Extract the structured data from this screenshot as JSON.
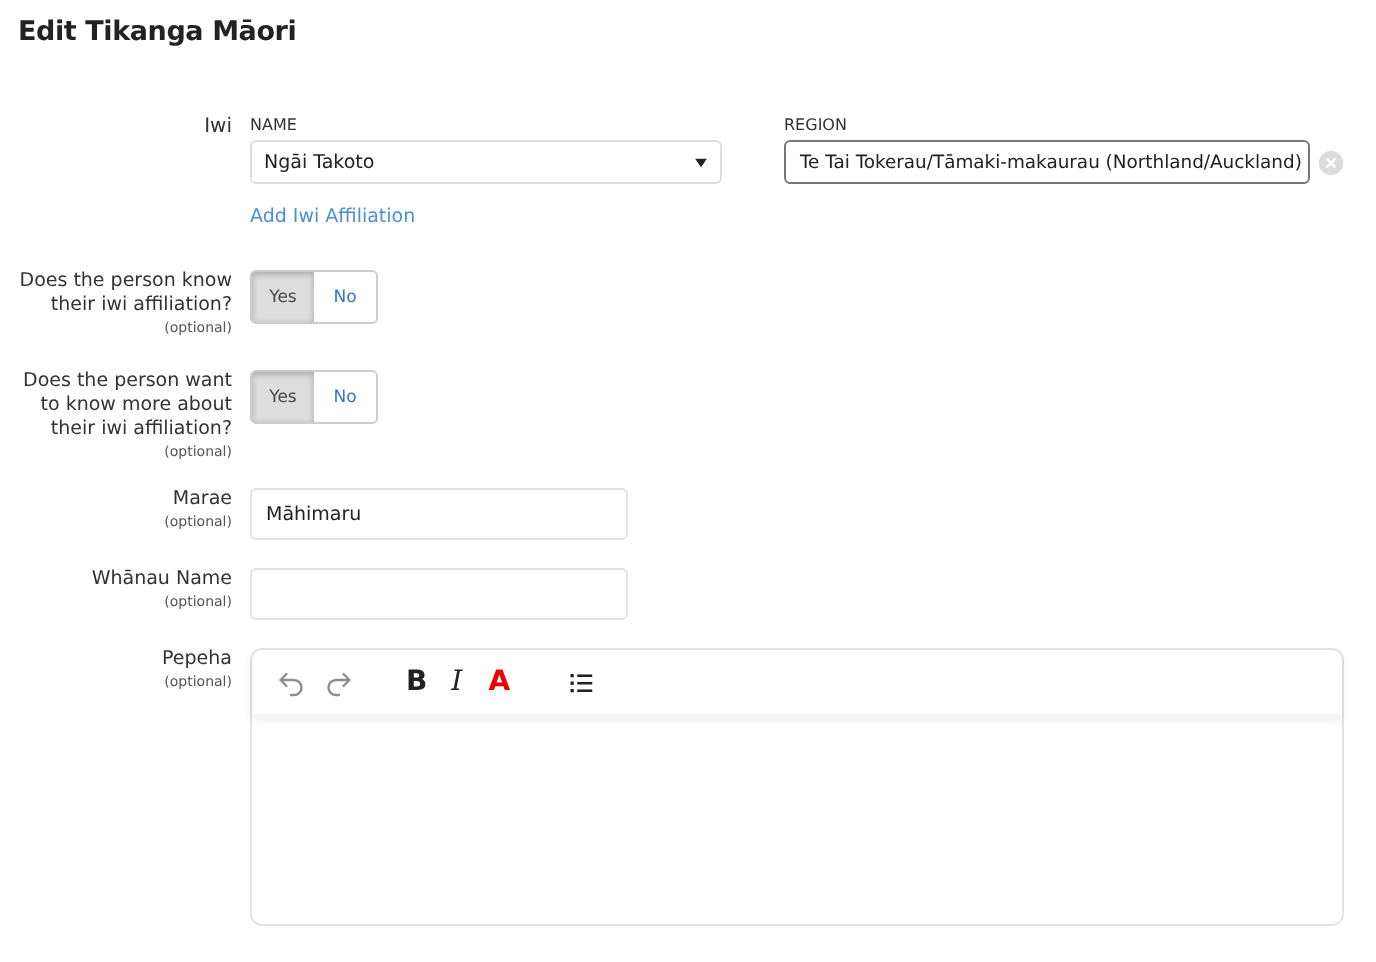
{
  "title": "Edit Tikanga Māori",
  "rows": [
    {
      "kind": "iwi",
      "label": "Iwi",
      "name_label": "NAME",
      "name_value": "Ngāi Takoto",
      "region_label": "REGION",
      "region_value": "Te Tai Tokerau/Tāmaki-makaurau (Northland/Auckland)",
      "add_link": "Add Iwi Affiliation"
    },
    {
      "kind": "toggle",
      "label": "Does the person know their iwi affiliation?",
      "optional": "(optional)",
      "options": [
        {
          "label": "Yes",
          "selected": true
        },
        {
          "label": "No",
          "selected": false
        }
      ]
    },
    {
      "kind": "toggle",
      "label": "Does the person want to know more about their iwi affiliation?",
      "optional": "(optional)",
      "options": [
        {
          "label": "Yes",
          "selected": true
        },
        {
          "label": "No",
          "selected": false
        }
      ]
    },
    {
      "kind": "text",
      "label": "Marae",
      "optional": "(optional)",
      "value": "Māhimaru"
    },
    {
      "kind": "text",
      "label": "Whānau Name",
      "optional": "(optional)",
      "value": ""
    },
    {
      "kind": "editor",
      "label": "Pepeha",
      "optional": "(optional)",
      "toolbar": [
        {
          "kind": "undo",
          "disabled": true
        },
        {
          "kind": "redo",
          "disabled": true
        },
        {
          "kind": "bold",
          "label": "B",
          "disabled": false
        },
        {
          "kind": "italic",
          "label": "I",
          "disabled": false
        },
        {
          "kind": "color",
          "label": "A",
          "disabled": false
        },
        {
          "kind": "list",
          "disabled": false
        }
      ]
    }
  ]
}
